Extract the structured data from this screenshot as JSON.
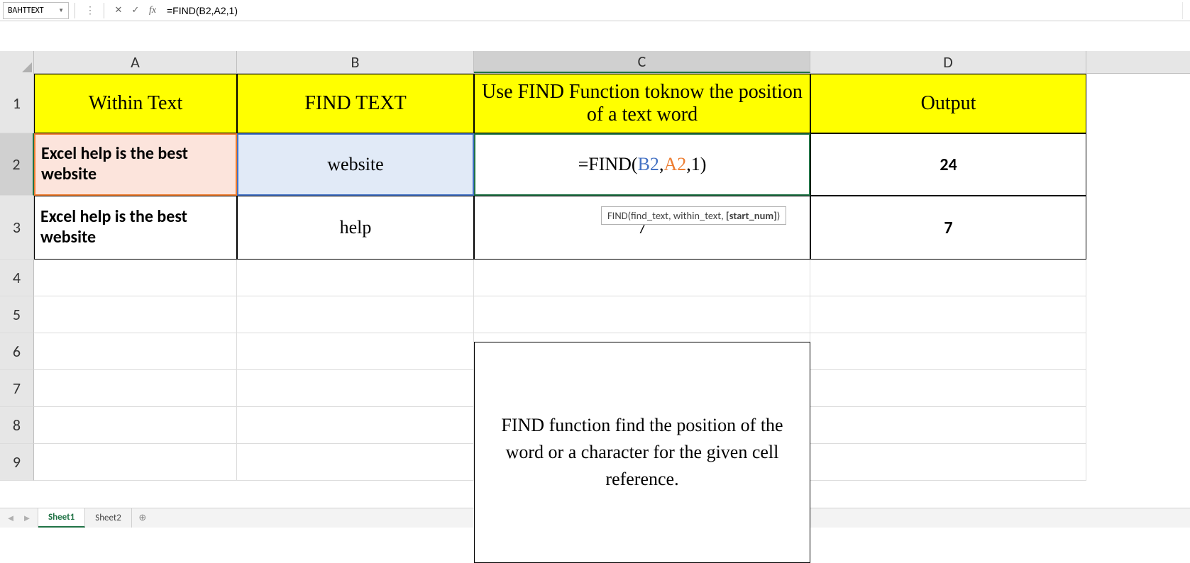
{
  "formula_bar": {
    "name_box": "BAHTTEXT",
    "fx_label": "fx",
    "formula": "=FIND(B2,A2,1)"
  },
  "columns": [
    "A",
    "B",
    "C",
    "D"
  ],
  "row_numbers": [
    "1",
    "2",
    "3",
    "4",
    "5",
    "6",
    "7",
    "8",
    "9"
  ],
  "headers": {
    "A": "Within Text",
    "B": "FIND TEXT",
    "C": "Use FIND Function toknow the position of a text word",
    "D": "Output"
  },
  "row2": {
    "A": "Excel help is the best website",
    "B": "website",
    "C_prefix": "=FIND(",
    "C_b2": "B2",
    "C_sep1": ",",
    "C_a2": "A2",
    "C_sep2": ",1",
    "C_suffix": ")",
    "D": "24"
  },
  "row3": {
    "A": "Excel help is the best website",
    "B": "help",
    "C": "7",
    "D": "7"
  },
  "tooltip": {
    "pre": "FIND(find_text, within_text, ",
    "bold": "[start_num]",
    "post": ")"
  },
  "description": "FIND function find the position of the word or a character for the given cell reference.",
  "tabs": {
    "sheet1": "Sheet1",
    "sheet2": "Sheet2"
  }
}
